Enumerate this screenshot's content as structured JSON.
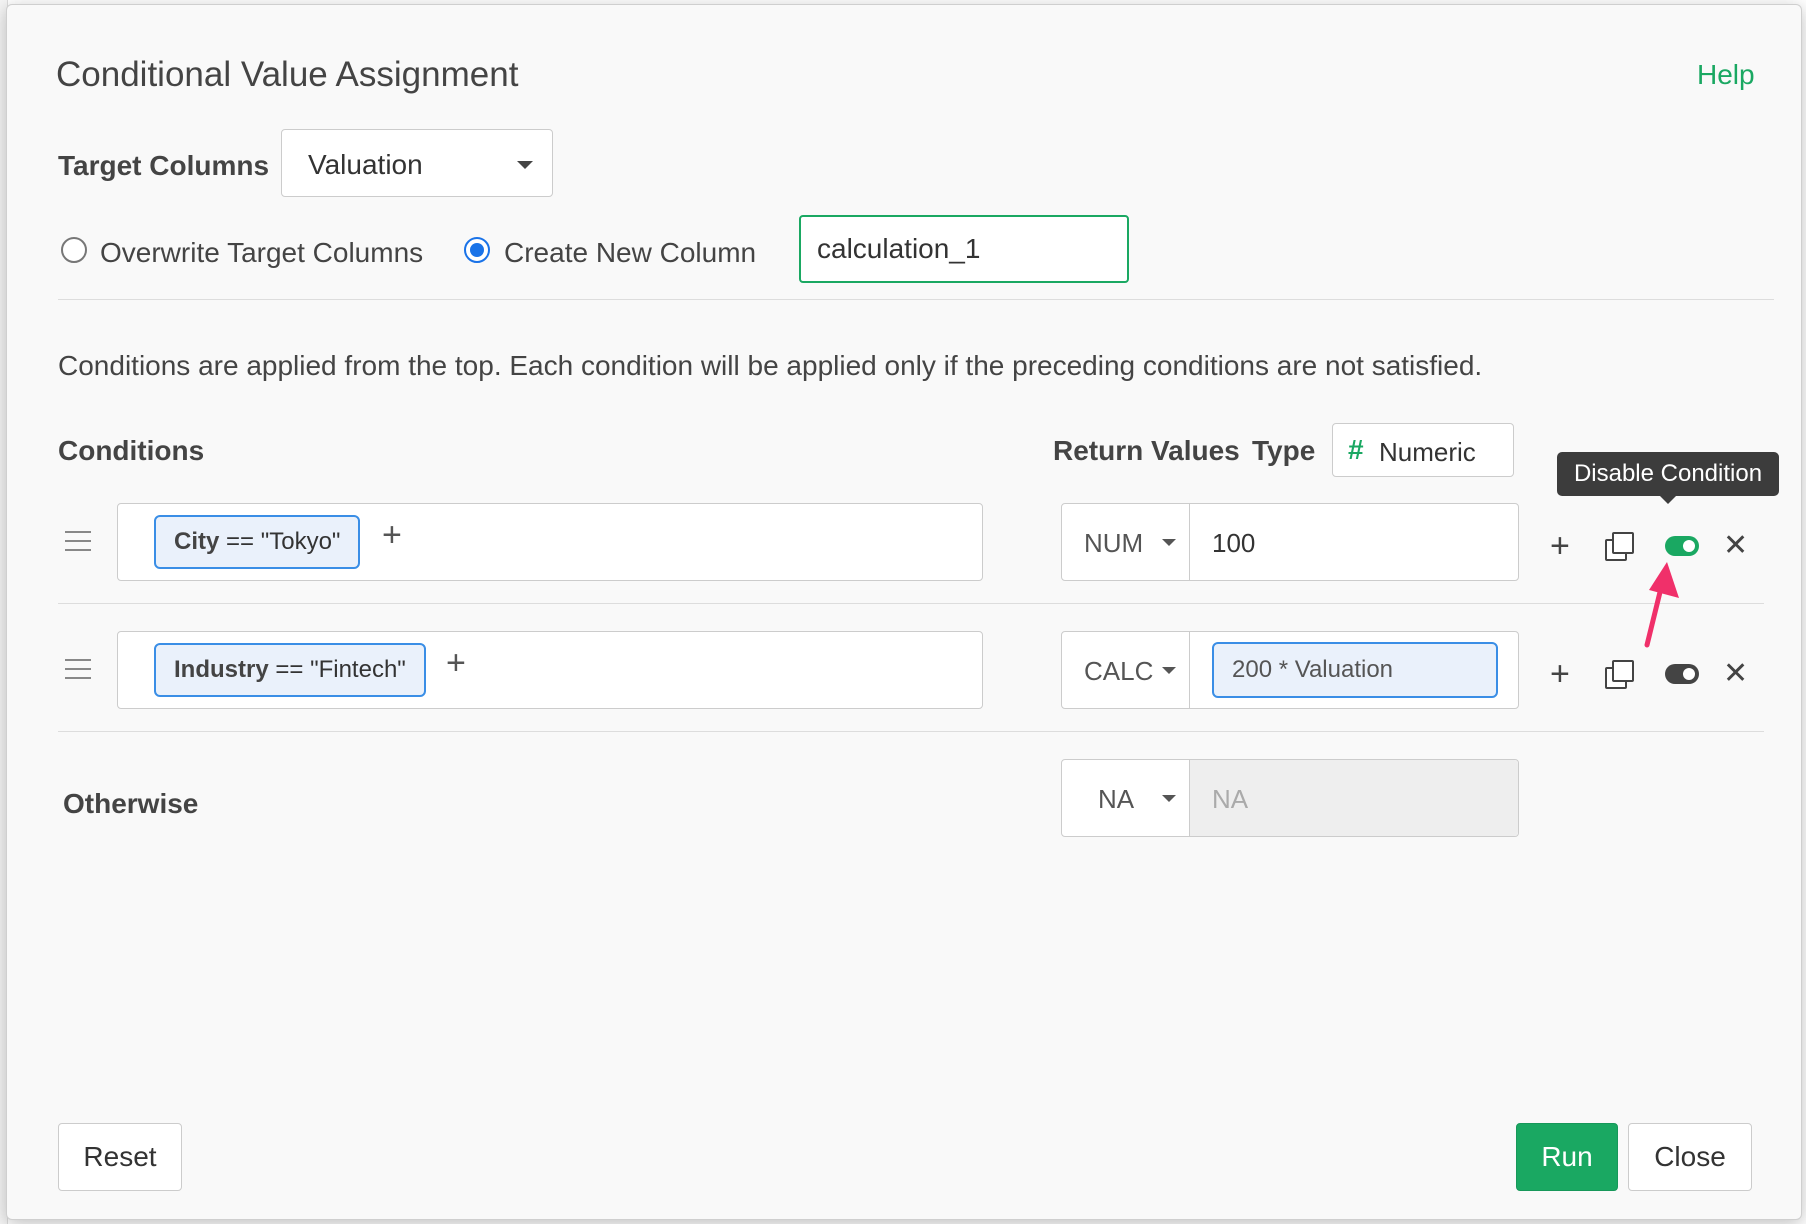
{
  "dialog": {
    "title": "Conditional Value Assignment",
    "help_label": "Help"
  },
  "target": {
    "label": "Target Columns",
    "selected": "Valuation"
  },
  "mode": {
    "overwrite_label": "Overwrite Target Columns",
    "create_label": "Create New Column",
    "selected": "create",
    "new_column_name": "calculation_1"
  },
  "description": "Conditions are applied from the top. Each condition will be applied only if the preceding conditions are not satisfied.",
  "headers": {
    "conditions": "Conditions",
    "return_values": "Return Values",
    "type": "Type",
    "type_value": "Numeric",
    "type_icon": "#"
  },
  "tooltip": "Disable Condition",
  "conditions": [
    {
      "field": "City",
      "operator": "==",
      "value": "\"Tokyo\"",
      "return_type": "NUM",
      "return_value": "100",
      "enabled": true
    },
    {
      "field": "Industry",
      "operator": "==",
      "value": "\"Fintech\"",
      "return_type": "CALC",
      "return_value": "200 * Valuation",
      "enabled": false
    }
  ],
  "otherwise": {
    "label": "Otherwise",
    "return_type": "NA",
    "placeholder": "NA"
  },
  "icons": {
    "add": "+",
    "remove": "✕"
  },
  "footer": {
    "reset_label": "Reset",
    "run_label": "Run",
    "close_label": "Close"
  },
  "colors": {
    "accent_green": "#1aa862",
    "focus_blue": "#3a8ee6",
    "arrow_pink": "#f0306a"
  }
}
